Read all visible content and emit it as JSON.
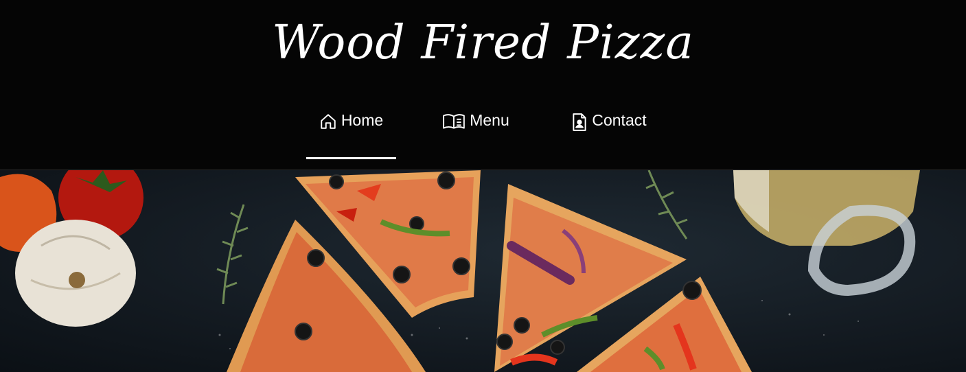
{
  "header": {
    "brand_title": "Wood Fired Pizza"
  },
  "nav": {
    "items": [
      {
        "label": "Home",
        "icon": "home-icon",
        "active": true
      },
      {
        "label": "Menu",
        "icon": "book-icon",
        "active": false
      },
      {
        "label": "Contact",
        "icon": "contact-file-icon",
        "active": false
      }
    ]
  },
  "colors": {
    "background": "#050505",
    "text": "#ffffff",
    "hero_table": "#141b22"
  },
  "hero": {
    "image_subject": "pizza-slices-photo"
  }
}
